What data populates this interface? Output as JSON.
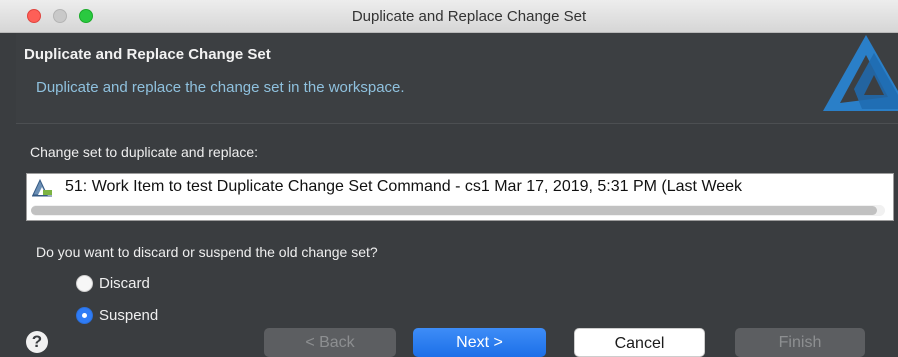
{
  "window": {
    "title": "Duplicate and Replace Change Set"
  },
  "banner": {
    "title": "Duplicate and Replace Change Set",
    "description": "Duplicate and replace the change set in the workspace.",
    "logo_icon": "jazz-triangle-logo-icon"
  },
  "change_set": {
    "label": "Change set to duplicate and replace:",
    "items": [
      {
        "icon": "change-set-icon",
        "text": "51: Work Item to test Duplicate Change Set Command - cs1  Mar 17, 2019, 5:31 PM (Last Week"
      }
    ]
  },
  "old_change_set": {
    "question": "Do you want to discard or suspend the old change set?",
    "options": [
      {
        "label": "Discard",
        "selected": false
      },
      {
        "label": "Suspend",
        "selected": true
      }
    ]
  },
  "buttons": {
    "help": "?",
    "back": "< Back",
    "next": "Next >",
    "cancel": "Cancel",
    "finish": "Finish"
  },
  "colors": {
    "accent": "#2f7cf6",
    "description_text": "#8fc1de",
    "background": "#3a3d40"
  }
}
